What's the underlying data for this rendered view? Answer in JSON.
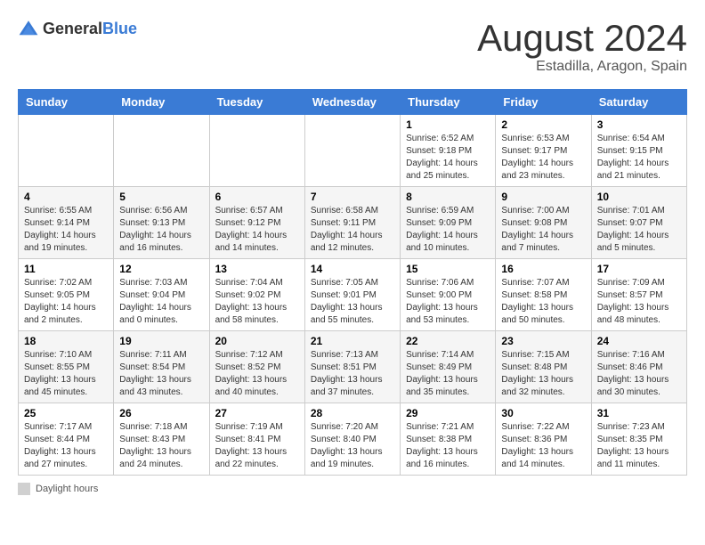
{
  "logo": {
    "text_general": "General",
    "text_blue": "Blue"
  },
  "title": "August 2024",
  "subtitle": "Estadilla, Aragon, Spain",
  "days_of_week": [
    "Sunday",
    "Monday",
    "Tuesday",
    "Wednesday",
    "Thursday",
    "Friday",
    "Saturday"
  ],
  "weeks": [
    [
      {
        "day": "",
        "info": ""
      },
      {
        "day": "",
        "info": ""
      },
      {
        "day": "",
        "info": ""
      },
      {
        "day": "",
        "info": ""
      },
      {
        "day": "1",
        "info": "Sunrise: 6:52 AM\nSunset: 9:18 PM\nDaylight: 14 hours and 25 minutes."
      },
      {
        "day": "2",
        "info": "Sunrise: 6:53 AM\nSunset: 9:17 PM\nDaylight: 14 hours and 23 minutes."
      },
      {
        "day": "3",
        "info": "Sunrise: 6:54 AM\nSunset: 9:15 PM\nDaylight: 14 hours and 21 minutes."
      }
    ],
    [
      {
        "day": "4",
        "info": "Sunrise: 6:55 AM\nSunset: 9:14 PM\nDaylight: 14 hours and 19 minutes."
      },
      {
        "day": "5",
        "info": "Sunrise: 6:56 AM\nSunset: 9:13 PM\nDaylight: 14 hours and 16 minutes."
      },
      {
        "day": "6",
        "info": "Sunrise: 6:57 AM\nSunset: 9:12 PM\nDaylight: 14 hours and 14 minutes."
      },
      {
        "day": "7",
        "info": "Sunrise: 6:58 AM\nSunset: 9:11 PM\nDaylight: 14 hours and 12 minutes."
      },
      {
        "day": "8",
        "info": "Sunrise: 6:59 AM\nSunset: 9:09 PM\nDaylight: 14 hours and 10 minutes."
      },
      {
        "day": "9",
        "info": "Sunrise: 7:00 AM\nSunset: 9:08 PM\nDaylight: 14 hours and 7 minutes."
      },
      {
        "day": "10",
        "info": "Sunrise: 7:01 AM\nSunset: 9:07 PM\nDaylight: 14 hours and 5 minutes."
      }
    ],
    [
      {
        "day": "11",
        "info": "Sunrise: 7:02 AM\nSunset: 9:05 PM\nDaylight: 14 hours and 2 minutes."
      },
      {
        "day": "12",
        "info": "Sunrise: 7:03 AM\nSunset: 9:04 PM\nDaylight: 14 hours and 0 minutes."
      },
      {
        "day": "13",
        "info": "Sunrise: 7:04 AM\nSunset: 9:02 PM\nDaylight: 13 hours and 58 minutes."
      },
      {
        "day": "14",
        "info": "Sunrise: 7:05 AM\nSunset: 9:01 PM\nDaylight: 13 hours and 55 minutes."
      },
      {
        "day": "15",
        "info": "Sunrise: 7:06 AM\nSunset: 9:00 PM\nDaylight: 13 hours and 53 minutes."
      },
      {
        "day": "16",
        "info": "Sunrise: 7:07 AM\nSunset: 8:58 PM\nDaylight: 13 hours and 50 minutes."
      },
      {
        "day": "17",
        "info": "Sunrise: 7:09 AM\nSunset: 8:57 PM\nDaylight: 13 hours and 48 minutes."
      }
    ],
    [
      {
        "day": "18",
        "info": "Sunrise: 7:10 AM\nSunset: 8:55 PM\nDaylight: 13 hours and 45 minutes."
      },
      {
        "day": "19",
        "info": "Sunrise: 7:11 AM\nSunset: 8:54 PM\nDaylight: 13 hours and 43 minutes."
      },
      {
        "day": "20",
        "info": "Sunrise: 7:12 AM\nSunset: 8:52 PM\nDaylight: 13 hours and 40 minutes."
      },
      {
        "day": "21",
        "info": "Sunrise: 7:13 AM\nSunset: 8:51 PM\nDaylight: 13 hours and 37 minutes."
      },
      {
        "day": "22",
        "info": "Sunrise: 7:14 AM\nSunset: 8:49 PM\nDaylight: 13 hours and 35 minutes."
      },
      {
        "day": "23",
        "info": "Sunrise: 7:15 AM\nSunset: 8:48 PM\nDaylight: 13 hours and 32 minutes."
      },
      {
        "day": "24",
        "info": "Sunrise: 7:16 AM\nSunset: 8:46 PM\nDaylight: 13 hours and 30 minutes."
      }
    ],
    [
      {
        "day": "25",
        "info": "Sunrise: 7:17 AM\nSunset: 8:44 PM\nDaylight: 13 hours and 27 minutes."
      },
      {
        "day": "26",
        "info": "Sunrise: 7:18 AM\nSunset: 8:43 PM\nDaylight: 13 hours and 24 minutes."
      },
      {
        "day": "27",
        "info": "Sunrise: 7:19 AM\nSunset: 8:41 PM\nDaylight: 13 hours and 22 minutes."
      },
      {
        "day": "28",
        "info": "Sunrise: 7:20 AM\nSunset: 8:40 PM\nDaylight: 13 hours and 19 minutes."
      },
      {
        "day": "29",
        "info": "Sunrise: 7:21 AM\nSunset: 8:38 PM\nDaylight: 13 hours and 16 minutes."
      },
      {
        "day": "30",
        "info": "Sunrise: 7:22 AM\nSunset: 8:36 PM\nDaylight: 13 hours and 14 minutes."
      },
      {
        "day": "31",
        "info": "Sunrise: 7:23 AM\nSunset: 8:35 PM\nDaylight: 13 hours and 11 minutes."
      }
    ]
  ],
  "footer": {
    "legend_label": "Daylight hours"
  }
}
